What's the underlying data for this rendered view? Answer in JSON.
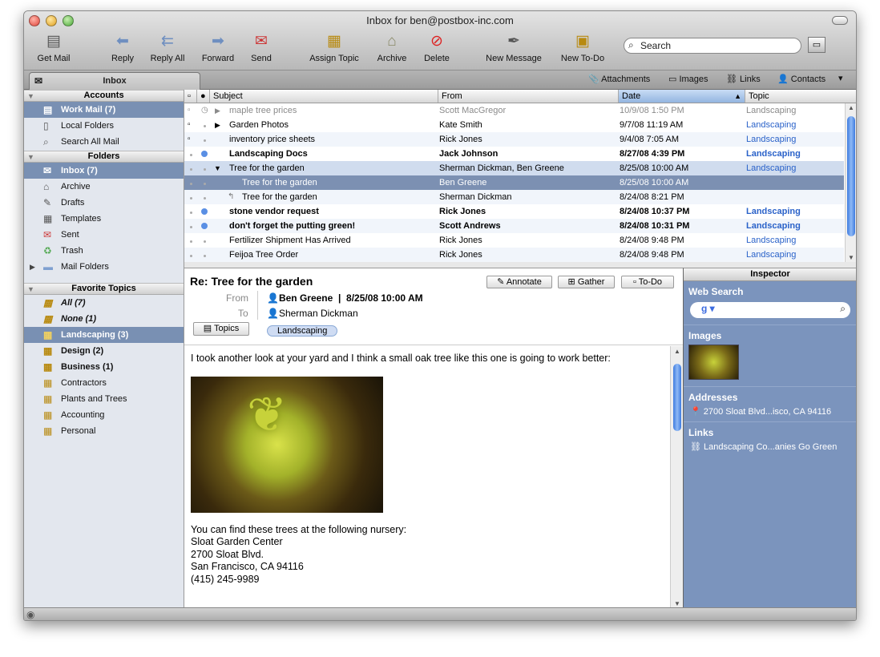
{
  "window": {
    "title": "Inbox for ben@postbox-inc.com"
  },
  "toolbar": {
    "get_mail": "Get Mail",
    "reply": "Reply",
    "reply_all": "Reply All",
    "forward": "Forward",
    "send": "Send",
    "assign_topic": "Assign Topic",
    "archive": "Archive",
    "delete": "Delete",
    "new_message": "New Message",
    "new_todo": "New To-Do",
    "search_placeholder": "Search"
  },
  "tabbar": {
    "tab": "Inbox",
    "filters": [
      "Attachments",
      "Images",
      "Links",
      "Contacts"
    ]
  },
  "sidebar": {
    "accounts_header": "Accounts",
    "accounts": [
      {
        "label": "Work Mail (7)",
        "icon": "mailbox-icon"
      },
      {
        "label": "Local Folders",
        "icon": "local-folders-icon"
      },
      {
        "label": "Search All Mail",
        "icon": "search-icon"
      }
    ],
    "folders_header": "Folders",
    "folders": [
      {
        "label": "Inbox (7)",
        "icon": "inbox-icon"
      },
      {
        "label": "Archive",
        "icon": "archive-icon"
      },
      {
        "label": "Drafts",
        "icon": "drafts-icon"
      },
      {
        "label": "Templates",
        "icon": "templates-icon"
      },
      {
        "label": "Sent",
        "icon": "sent-icon"
      },
      {
        "label": "Trash",
        "icon": "trash-icon"
      },
      {
        "label": "Mail Folders",
        "icon": "folder-icon"
      }
    ],
    "topics_header": "Favorite Topics",
    "topics": [
      {
        "label": "All (7)"
      },
      {
        "label": "None (1)"
      },
      {
        "label": "Landscaping (3)"
      },
      {
        "label": "Design (2)"
      },
      {
        "label": "Business (1)"
      },
      {
        "label": "Contractors"
      },
      {
        "label": "Plants and Trees"
      },
      {
        "label": "Accounting"
      },
      {
        "label": "Personal"
      }
    ]
  },
  "message_list": {
    "columns": {
      "subject": "Subject",
      "from": "From",
      "date": "Date",
      "topic": "Topic"
    },
    "rows": [
      {
        "subject": "maple tree prices",
        "from": "Scott MacGregor",
        "date": "10/9/08 1:50 PM",
        "topic": "Landscaping"
      },
      {
        "subject": "Garden Photos",
        "from": "Kate Smith",
        "date": "9/7/08 11:19 AM",
        "topic": "Landscaping"
      },
      {
        "subject": "inventory price sheets",
        "from": "Rick Jones",
        "date": "9/4/08 7:05 AM",
        "topic": "Landscaping"
      },
      {
        "subject": "Landscaping Docs",
        "from": "Jack Johnson",
        "date": "8/27/08 4:39 PM",
        "topic": "Landscaping"
      },
      {
        "subject": "Tree for the garden",
        "from": "Sherman Dickman, Ben Greene",
        "date": "8/25/08 10:00 AM",
        "topic": "Landscaping"
      },
      {
        "subject": "Tree for the garden",
        "from": "Ben Greene",
        "date": "8/25/08 10:00 AM",
        "topic": ""
      },
      {
        "subject": "Tree for the garden",
        "from": "Sherman Dickman",
        "date": "8/24/08 8:21 PM",
        "topic": ""
      },
      {
        "subject": "stone vendor request",
        "from": "Rick Jones",
        "date": "8/24/08 10:37 PM",
        "topic": "Landscaping"
      },
      {
        "subject": "don't forget the putting green!",
        "from": "Scott Andrews",
        "date": "8/24/08 10:31 PM",
        "topic": "Landscaping"
      },
      {
        "subject": "Fertilizer Shipment Has Arrived",
        "from": "Rick Jones",
        "date": "8/24/08 9:48 PM",
        "topic": "Landscaping"
      },
      {
        "subject": "Feijoa Tree Order",
        "from": "Rick Jones",
        "date": "8/24/08 9:48 PM",
        "topic": "Landscaping"
      }
    ]
  },
  "preview": {
    "subject": "Re: Tree for the garden",
    "annotate": "Annotate",
    "gather": "Gather",
    "todo": "To-Do",
    "from_label": "From",
    "from_value": "Ben Greene",
    "date": "8/25/08 10:00 AM",
    "to_label": "To",
    "to_value": "Sherman Dickman",
    "topics_button": "Topics",
    "topic_tag": "Landscaping",
    "body_intro": "I took another look at your yard and I think a small oak tree like this one is going to work better:",
    "body_lines": [
      "You can find these trees at the following nursery:",
      "Sloat Garden Center",
      "2700 Sloat Blvd.",
      "San Francisco, CA  94116",
      "(415) 245-9989"
    ]
  },
  "inspector": {
    "title": "Inspector",
    "web_search": "Web Search",
    "images": "Images",
    "addresses": "Addresses",
    "address_item": "2700 Sloat Blvd...isco, CA 94116",
    "links": "Links",
    "link_item": "Landscaping Co...anies Go Green"
  },
  "colors": {
    "accent": "#7990b3",
    "topic": "#2a62c9",
    "unread_dot": "#5a8fe4"
  }
}
